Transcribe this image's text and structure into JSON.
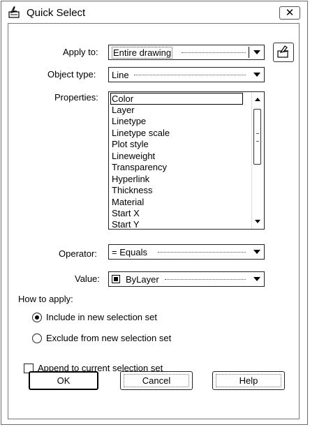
{
  "window": {
    "title": "Quick Select",
    "close_glyph": "✕"
  },
  "apply_to": {
    "label": "Apply to:",
    "value": "Entire drawing",
    "select_objects_icon": "select-objects-icon"
  },
  "object_type": {
    "label": "Object type:",
    "value": "Line"
  },
  "properties": {
    "label": "Properties:",
    "items": [
      "Color",
      "Layer",
      "Linetype",
      "Linetype scale",
      "Plot style",
      "Lineweight",
      "Transparency",
      "Hyperlink",
      "Thickness",
      "Material",
      "Start X",
      "Start Y"
    ],
    "selected": "Color"
  },
  "operator": {
    "label": "Operator:",
    "value": "= Equals"
  },
  "value": {
    "label": "Value:",
    "value": "ByLayer",
    "swatch_color": "#000000"
  },
  "how_to_apply": {
    "label": "How to apply:",
    "include": "Include in new selection set",
    "exclude": "Exclude from new selection set",
    "selected": "include"
  },
  "append": {
    "label": "Append to current selection set",
    "checked": false
  },
  "buttons": {
    "ok": "OK",
    "cancel": "Cancel",
    "help": "Help"
  }
}
